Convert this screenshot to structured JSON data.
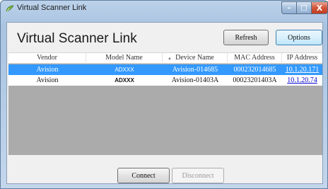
{
  "window": {
    "title": "Virtual Scanner Link",
    "minimize_symbol": "–",
    "maximize_symbol": "□",
    "close_symbol": "X"
  },
  "header": {
    "app_title": "Virtual Scanner Link",
    "refresh_label": "Refresh",
    "options_label": "Options"
  },
  "table": {
    "columns": [
      "Vendor",
      "Model Name",
      "Device Name",
      "MAC Address",
      "IP Address"
    ],
    "sort_indicator": "▲",
    "rows": [
      {
        "vendor": "Avision",
        "model": "ADXXX",
        "device": "Avision-014685",
        "mac": "000232014685",
        "ip": "10.1.20.171",
        "selected": true
      },
      {
        "vendor": "Avision",
        "model": "ADXXX",
        "device": "Avision-01403A",
        "mac": "00023201403A",
        "ip": "10.1.20.74",
        "selected": false
      }
    ]
  },
  "footer": {
    "connect_label": "Connect",
    "disconnect_label": "Disconnect"
  },
  "colors": {
    "selection": "#3399ff",
    "list_background": "#ababab",
    "link": "#0000cc"
  }
}
